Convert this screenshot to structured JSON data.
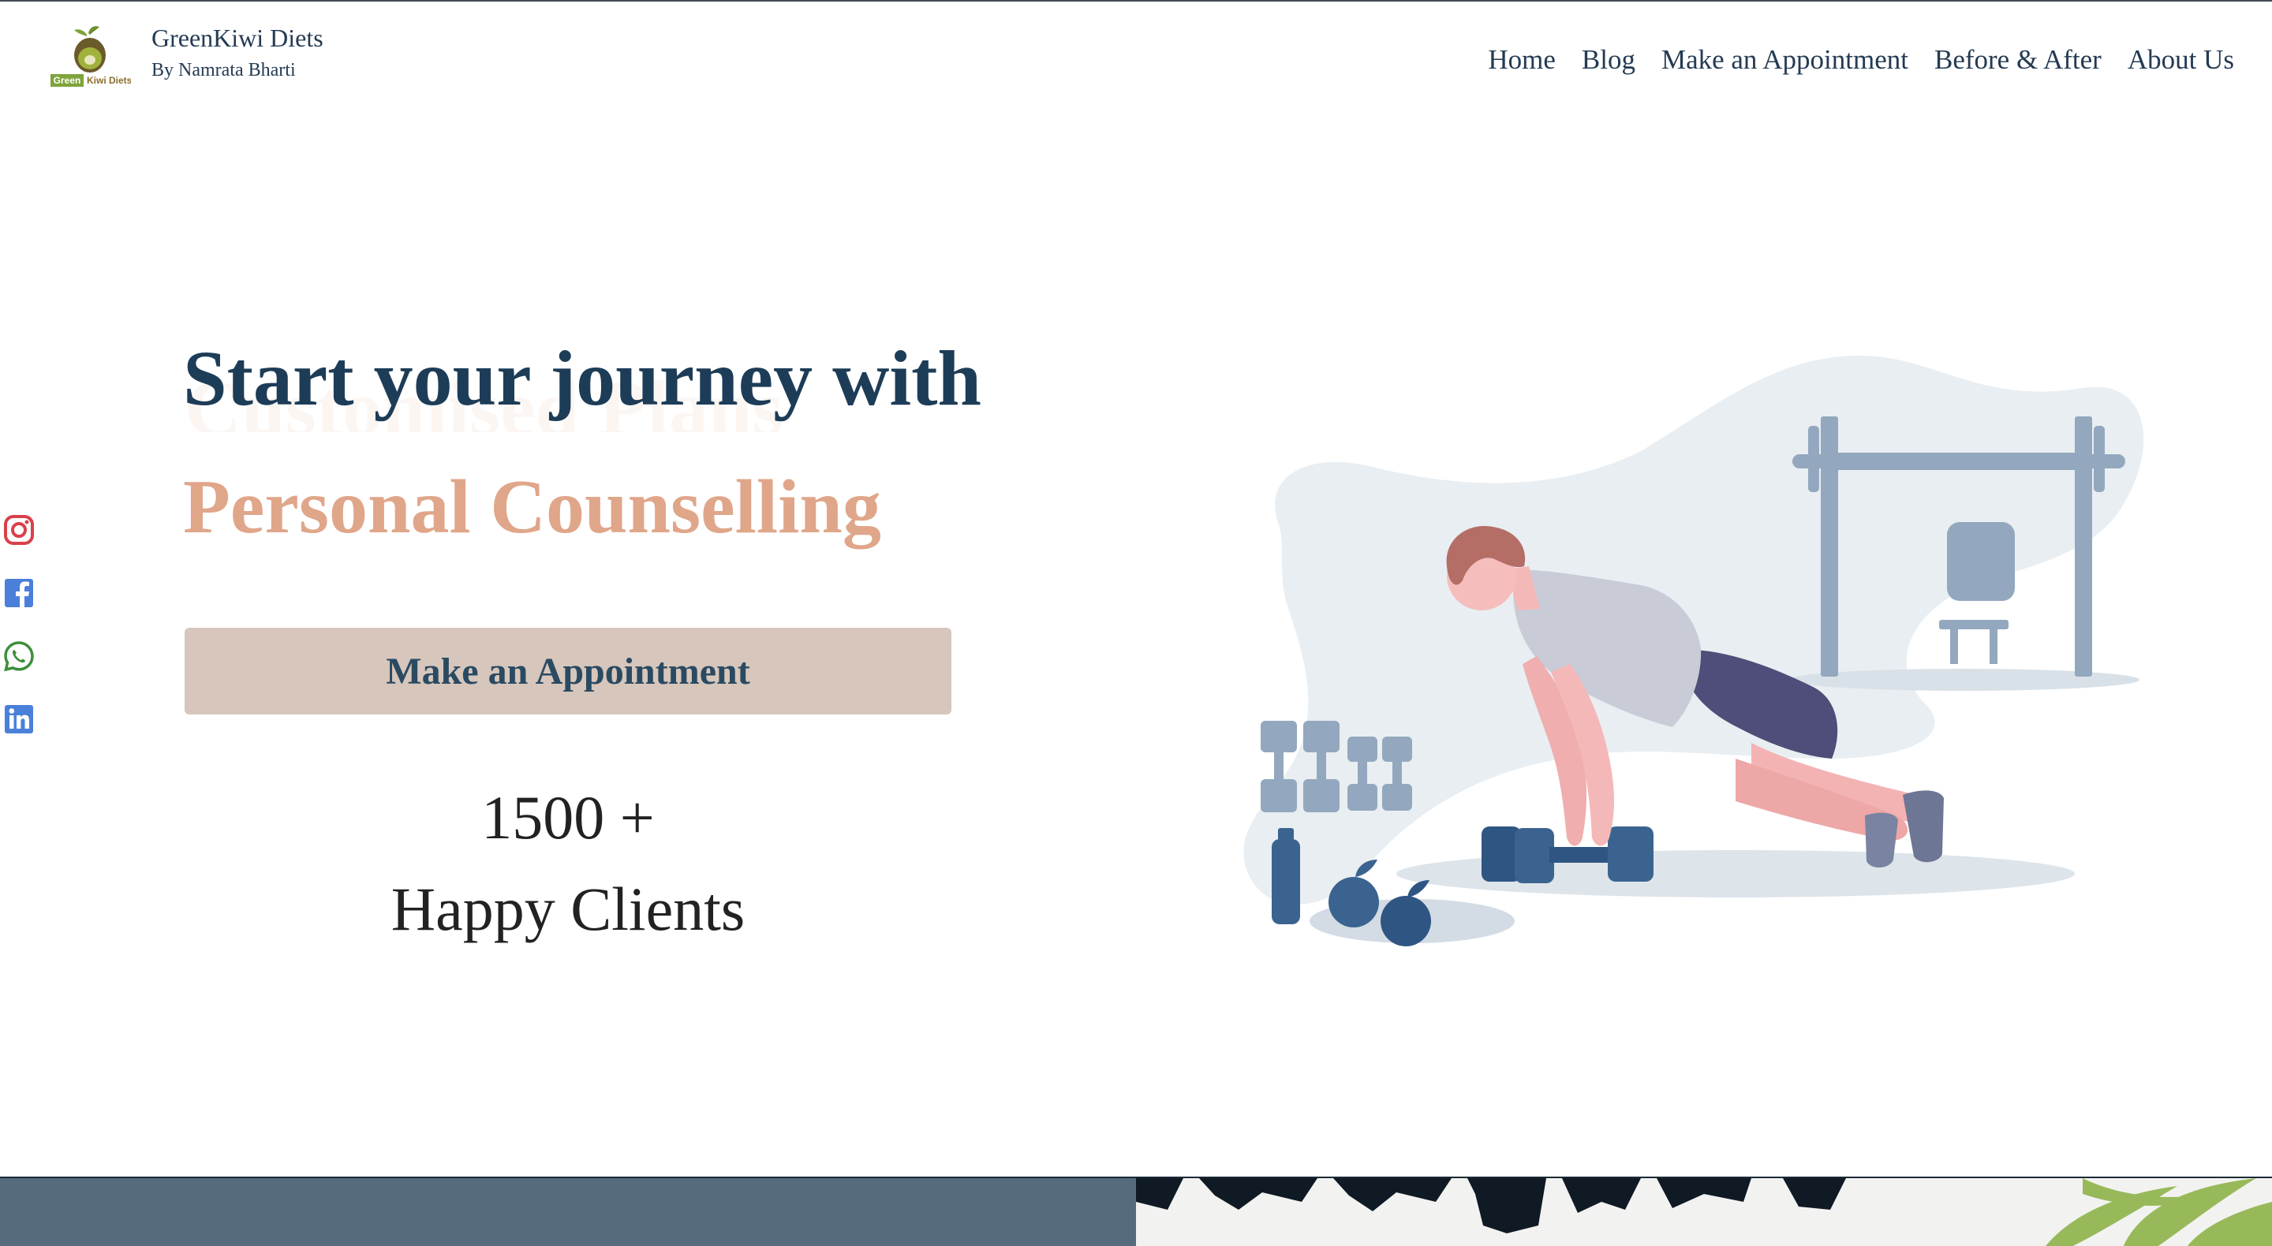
{
  "header": {
    "brand_name": "GreenKiwi Diets",
    "brand_subtitle": "By Namrata Bharti",
    "logo_text_green": "Green",
    "logo_text_brown": "Kiwi Diets",
    "logo_icon": "kiwi-logo-icon"
  },
  "nav": {
    "items": [
      {
        "label": "Home"
      },
      {
        "label": "Blog"
      },
      {
        "label": "Make an Appointment"
      },
      {
        "label": "Before & After"
      },
      {
        "label": "About Us"
      }
    ]
  },
  "social": {
    "icons": [
      "instagram-icon",
      "facebook-icon",
      "whatsapp-icon",
      "linkedin-icon"
    ],
    "colors": {
      "instagram": "#d9414b",
      "facebook": "#4a80d9",
      "whatsapp": "#3d8f3d",
      "linkedin": "#4a80d9"
    }
  },
  "hero": {
    "title": "Start your journey with",
    "ghost_text": "Customised Plans",
    "rotating_text": "Personal Counselling",
    "cta_label": "Make an Appointment",
    "stat_number": "1500 +",
    "stat_label": "Happy Clients",
    "illustration_icon": "workout-illustration"
  },
  "colors": {
    "navy": "#1d3c57",
    "peach": "#e0a68a",
    "cta_bg": "#d7c6bb",
    "bottom_panel": "#566c7c"
  }
}
